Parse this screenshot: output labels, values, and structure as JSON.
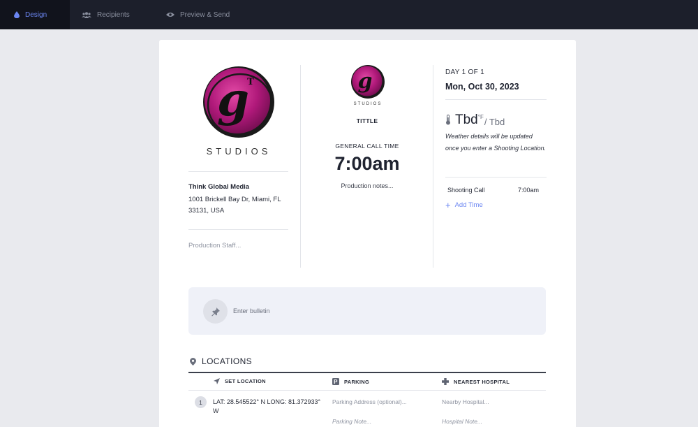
{
  "nav": {
    "tabs": [
      {
        "label": "Design",
        "icon": "droplet-icon",
        "active": true
      },
      {
        "label": "Recipients",
        "icon": "people-icon",
        "active": false
      },
      {
        "label": "Preview & Send",
        "icon": "eye-icon",
        "active": false
      }
    ]
  },
  "header": {
    "logo_text": "STUDIOS",
    "company": "Think Global Media",
    "address": "1001 Brickell Bay Dr, Miami, FL 33131, USA",
    "staff_placeholder": "Production Staff...",
    "title": "TITTLE",
    "general_call_label": "GENERAL CALL TIME",
    "general_call_time": "7:00am",
    "production_notes_placeholder": "Production notes...",
    "day_label": "DAY 1 OF 1",
    "date": "Mon, Oct 30, 2023",
    "temperature": "Tbd",
    "temperature_unit": "°F",
    "temperature_alt": "/ Tbd",
    "weather_note": "Weather details will be updated once you enter a Shooting Location.",
    "shooting_call_label": "Shooting Call",
    "shooting_call_time": "7:00am",
    "add_time_label": "Add Time"
  },
  "bulletin": {
    "placeholder": "Enter bulletin"
  },
  "locations": {
    "title": "LOCATIONS",
    "columns": [
      {
        "label": "SET LOCATION",
        "icon": "navigation-arrow-icon"
      },
      {
        "label": "PARKING",
        "icon": "parking-icon"
      },
      {
        "label": "NEAREST HOSPITAL",
        "icon": "medical-cross-icon"
      }
    ],
    "rows": [
      {
        "number": "1",
        "set_location": "LAT: 28.545522° N LONG: 81.372933° W",
        "parking_address_placeholder": "Parking Address (optional)...",
        "parking_note_placeholder": "Parking Note...",
        "hospital_placeholder": "Nearby Hospital...",
        "hospital_note_placeholder": "Hospital Note..."
      }
    ]
  },
  "colors": {
    "nav_bg": "#1c1f2b",
    "nav_active_bg": "#11131c",
    "accent": "#6b86f2",
    "logo_magenta": "#b0197a",
    "page_bg": "#e9eaee"
  }
}
